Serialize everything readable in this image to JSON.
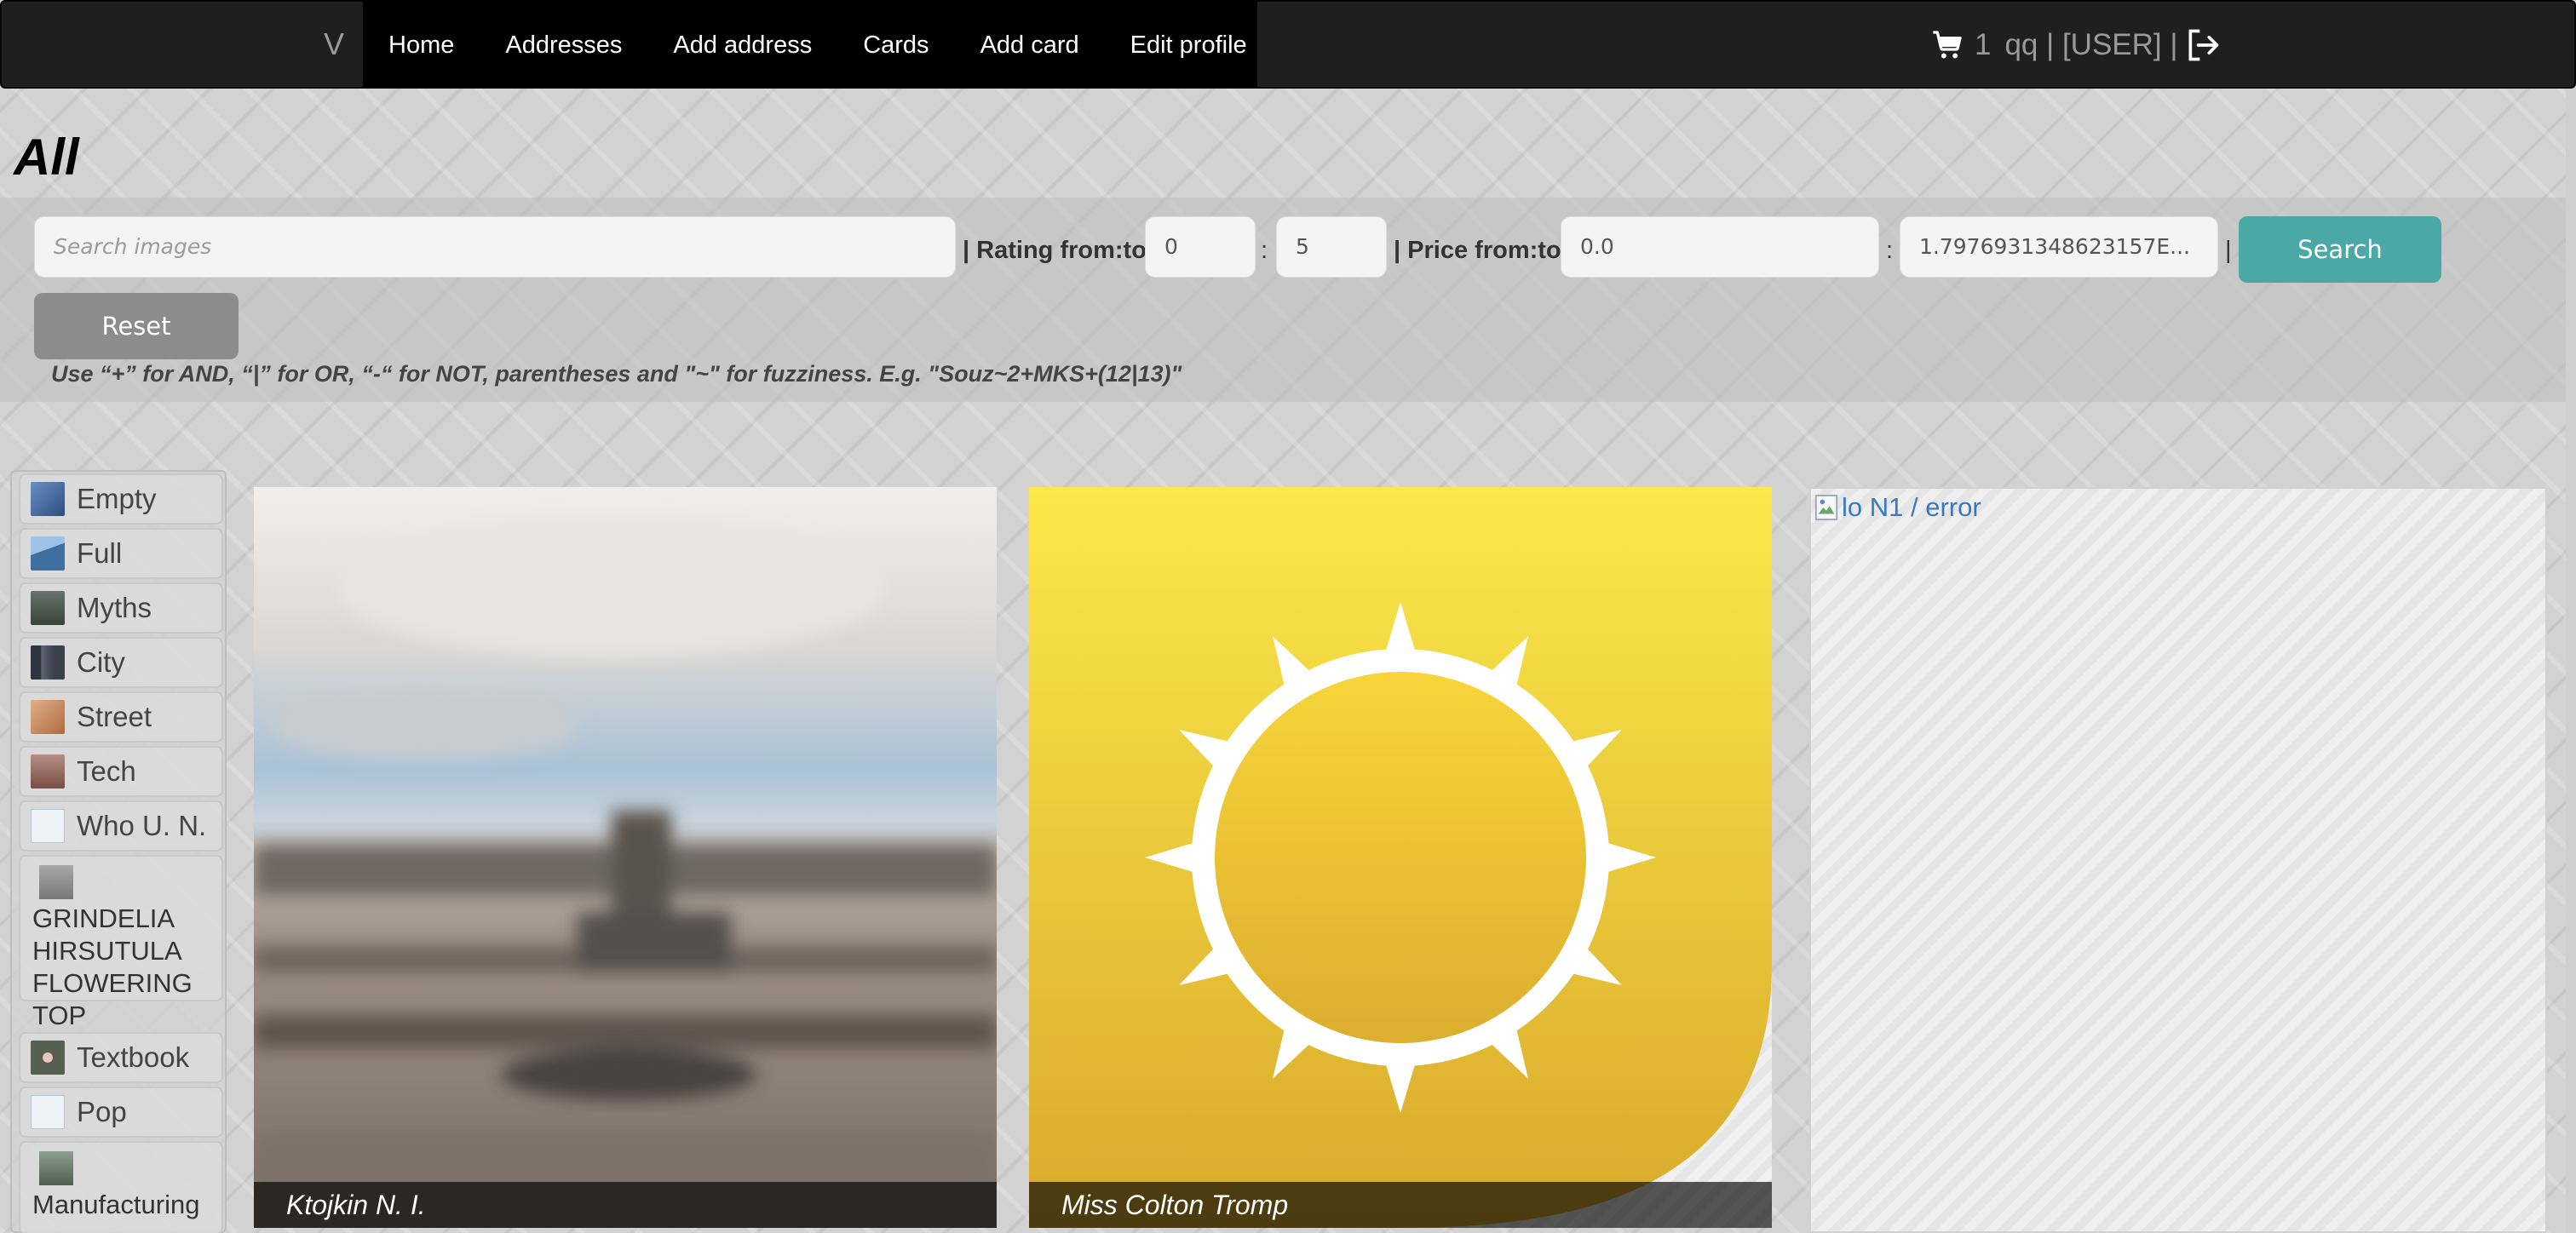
{
  "navbar": {
    "brand": "V",
    "links": [
      "Home",
      "Addresses",
      "Add address",
      "Cards",
      "Add card",
      "Edit profile"
    ],
    "cart_count": "1",
    "user_text": "qq | [USER] |",
    "icons": [
      "cart-icon",
      "logout-icon"
    ]
  },
  "page": {
    "title": "All"
  },
  "search": {
    "query_placeholder": "Search images",
    "rating_label": "| Rating from:to",
    "rating_from": "0",
    "rating_to": "5",
    "colon": ":",
    "price_label": "| Price from:to",
    "price_from": "0.0",
    "price_to": "1.7976931348623157E...",
    "pipe": "|",
    "search_button": "Search",
    "reset_button": "Reset",
    "hint": "Use “+” for AND, “|” for OR, “-“ for NOT, parentheses and \"~\" for fuzziness. E.g. \"Souz~2+MKS+(12|13)\""
  },
  "sidebar": {
    "items": [
      {
        "label": "Empty",
        "thumb_color": "#4a6fa5"
      },
      {
        "label": "Full",
        "thumb_color": "#5b8fc0"
      },
      {
        "label": "Myths",
        "thumb_color": "#4f5e55"
      },
      {
        "label": "City",
        "thumb_color": "#3f4652"
      },
      {
        "label": "Street",
        "thumb_color": "#c98a5a"
      },
      {
        "label": "Tech",
        "thumb_color": "#9a6b5e"
      },
      {
        "label": "Who U. N.",
        "thumb_color": "#c9d6e6"
      },
      {
        "label": "GRINDELIA HIRSUTULA FLOWERING TOP",
        "thumb_color": "#8e8e8e"
      },
      {
        "label": "Textbook",
        "thumb_color": "#5b6b55"
      },
      {
        "label": "Pop",
        "thumb_color": "#c9d6e6"
      },
      {
        "label": "Manufacturing",
        "thumb_color": "#6a7b6a"
      }
    ]
  },
  "cards": [
    {
      "caption": "Ktojkin N. I.",
      "kind": "photo"
    },
    {
      "caption": "Miss Colton Tromp",
      "kind": "sun-icon",
      "accent": "#f2d33c"
    },
    {
      "caption": "",
      "broken_alt": "lo N1 / error"
    }
  ],
  "colors": {
    "navbar_bg": "#1f1f1f",
    "search_button": "#4aa9a4",
    "reset_button": "#8c8c8c",
    "link_blue": "#3b78c2"
  }
}
